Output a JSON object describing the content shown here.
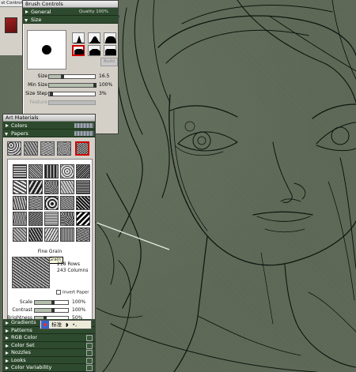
{
  "back_panel": {
    "tab_label": "st Control"
  },
  "brush_controls": {
    "title": "Brush Controls",
    "sections": {
      "general": "General",
      "general_extra": "Quality 100%",
      "size": "Size"
    },
    "build_button": "Build",
    "sliders": [
      {
        "label": "Size",
        "value_text": "16.5",
        "level": 0.3,
        "enabled": true
      },
      {
        "label": "Min Size",
        "value_text": "100%",
        "level": 1.0,
        "enabled": true
      },
      {
        "label": "Size Step",
        "value_text": "3%",
        "level": 0.05,
        "enabled": true
      },
      {
        "label": "Feature",
        "value_text": "",
        "level": 0.0,
        "enabled": false
      }
    ]
  },
  "art_materials": {
    "title": "Art Materials",
    "sections": {
      "colors": "Colors",
      "papers": "Papers"
    },
    "tooltip": "Fine Grain",
    "paper_name": "Fine Grain",
    "rows": "218 Rows",
    "columns": "243 Columns",
    "invert_label": "Invert Paper",
    "sliders": [
      {
        "label": "Scale",
        "value_text": "100%",
        "level": 0.55
      },
      {
        "label": "Contrast",
        "value_text": "100%",
        "level": 0.55
      },
      {
        "label": "Brightness",
        "value_text": "50%",
        "level": 0.3
      }
    ],
    "lower_sections": [
      "Gradients",
      "Patterns",
      "RGB Color",
      "Color Set",
      "Nozzles",
      "Looks",
      "Color Variability"
    ]
  },
  "ime_bar": {
    "chars": "标准",
    "moon": "◗",
    "dots": "•,"
  }
}
